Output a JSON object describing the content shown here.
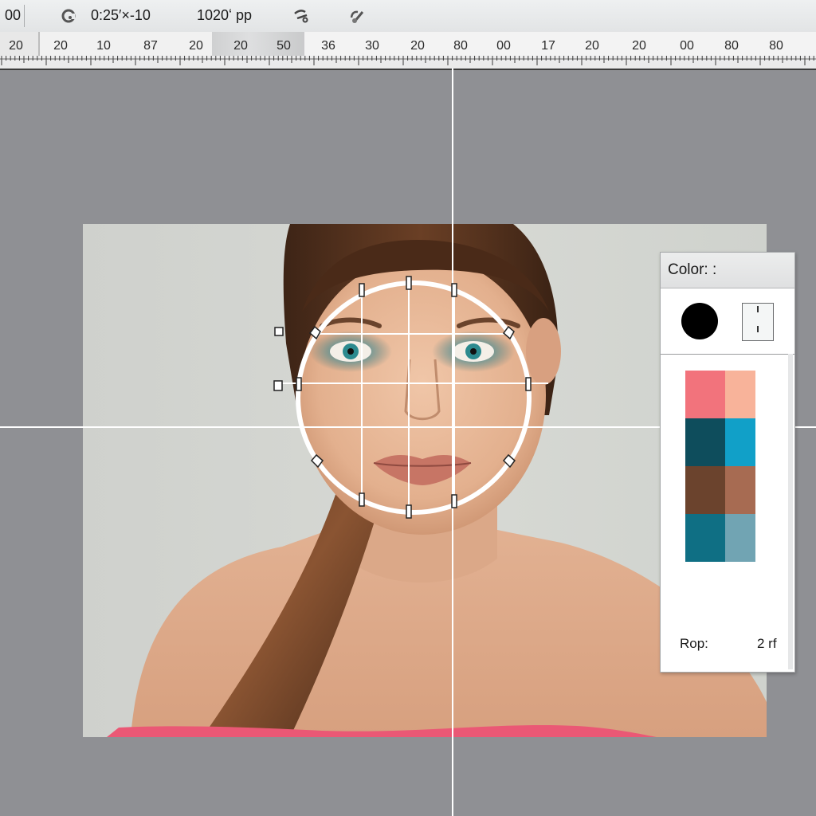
{
  "toolbar": {
    "left_value": "00",
    "undo_icon": "undo-icon",
    "time_text": "0:25′×-10",
    "resolution_text": "1020ʻ pp",
    "scissor_icon": "scissors-icon",
    "brush_icon": "brush-icon"
  },
  "ruler": {
    "labels": [
      "20",
      "20",
      "10",
      "87",
      "20",
      "20",
      "50",
      "36",
      "30",
      "20",
      "80",
      "00",
      "17",
      "20",
      "20",
      "00",
      "80",
      "80"
    ]
  },
  "color_panel": {
    "title": "Color: :",
    "foreground_color": "#000000",
    "background_icon": "background-swatch-icon",
    "swatches": [
      [
        "#f2737c",
        "#f8b39a"
      ],
      [
        "#0e4d5c",
        "#11a0c8"
      ],
      [
        "#6b432d",
        "#a76b52"
      ],
      [
        "#0f6f84",
        "#71a4b3"
      ]
    ],
    "footer_label": "Rop:",
    "footer_value": "2 rf"
  },
  "canvas": {
    "accent_color": "#ffffff",
    "sweater_color": "#ea5875"
  }
}
